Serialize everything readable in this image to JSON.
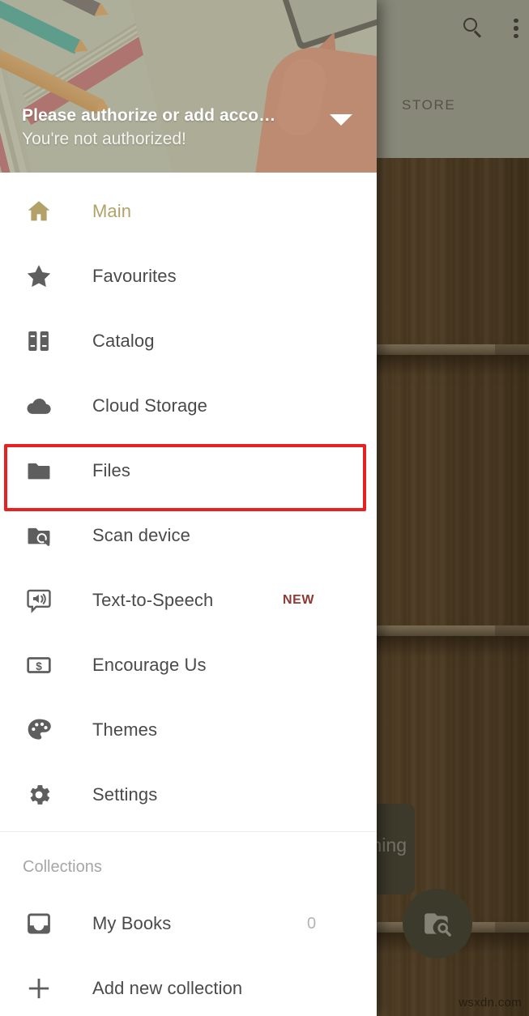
{
  "background_app": {
    "tab_label": "STORE",
    "search_icon": "search-icon",
    "overflow_icon": "more-vertical-icon",
    "fab_icon": "folder-scan-icon",
    "tooltip_text": "hing",
    "watermark": "wsxdn.com",
    "wood_color": "#6d5230",
    "shelf_color": "#8b7a5f"
  },
  "drawer": {
    "header": {
      "title": "Please authorize or add acco…",
      "subtitle": "You're not authorized!",
      "caret_icon": "chevron-down-icon",
      "overlay_color": "#8b8c76"
    },
    "nav_items": [
      {
        "id": "main",
        "label": "Main",
        "icon": "home-icon",
        "active": true
      },
      {
        "id": "favourites",
        "label": "Favourites",
        "icon": "star-icon",
        "active": false
      },
      {
        "id": "catalog",
        "label": "Catalog",
        "icon": "books-icon",
        "active": false
      },
      {
        "id": "cloud-storage",
        "label": "Cloud Storage",
        "icon": "cloud-icon",
        "active": false
      },
      {
        "id": "files",
        "label": "Files",
        "icon": "folder-icon",
        "active": false,
        "highlighted": true
      },
      {
        "id": "scan-device",
        "label": "Scan device",
        "icon": "folder-scan-icon",
        "active": false
      },
      {
        "id": "text-to-speech",
        "label": "Text-to-Speech",
        "icon": "speech-bubble-speaker-icon",
        "active": false,
        "badge": "NEW"
      },
      {
        "id": "encourage-us",
        "label": "Encourage Us",
        "icon": "money-icon",
        "active": false
      },
      {
        "id": "themes",
        "label": "Themes",
        "icon": "palette-icon",
        "active": false
      },
      {
        "id": "settings",
        "label": "Settings",
        "icon": "gear-icon",
        "active": false
      }
    ],
    "collections": {
      "section_title": "Collections",
      "items": [
        {
          "id": "my-books",
          "label": "My Books",
          "icon": "inbox-icon",
          "count": "0"
        },
        {
          "id": "add-new-collection",
          "label": "Add new collection",
          "icon": "plus-icon",
          "count": ""
        }
      ]
    },
    "active_color": "#b2a269",
    "badge_color": "#8d3a33",
    "highlight_color": "#e7211f"
  }
}
